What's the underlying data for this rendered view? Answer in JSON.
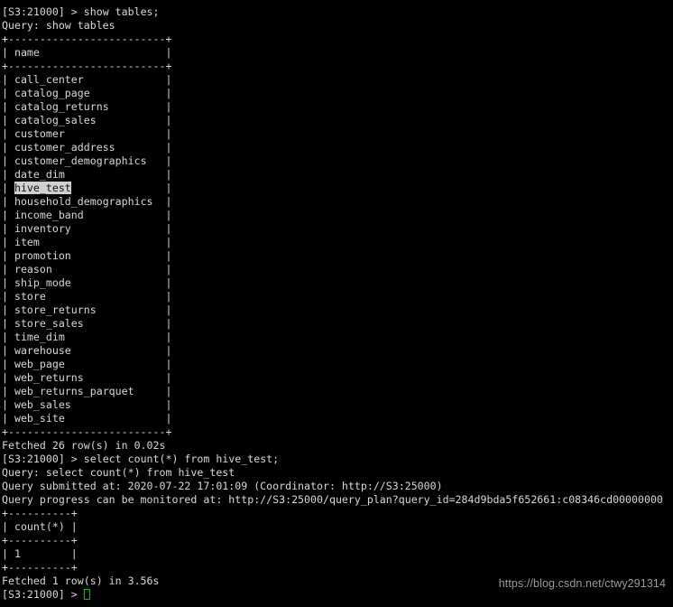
{
  "terminal": {
    "app": "impala-shell",
    "colors": {
      "background": "#000000",
      "foreground": "#d8d8d8",
      "cursor": "#00c000",
      "selection_background": "#d0d0d0",
      "selection_foreground": "#101010",
      "watermark": "#9a9a9a"
    },
    "prompt": "[S3:21000] > ",
    "cursor_glyph": "block-outline-cursor"
  },
  "session": {
    "command_1": {
      "prompt": "[S3:21000] > ",
      "input": "show tables;",
      "echo": "Query: show tables",
      "table": {
        "top_border": "+-------------------------+",
        "header_row": "| name                    |",
        "header_separator": "+-------------------------+",
        "bottom_border": "+-------------------------+",
        "column_header": "name",
        "rows": [
          "call_center",
          "catalog_page",
          "catalog_returns",
          "catalog_sales",
          "customer",
          "customer_address",
          "customer_demographics",
          "date_dim",
          "hive_test",
          "household_demographics",
          "income_band",
          "inventory",
          "item",
          "promotion",
          "reason",
          "ship_mode",
          "store",
          "store_returns",
          "store_sales",
          "time_dim",
          "warehouse",
          "web_page",
          "web_returns",
          "web_returns_parquet",
          "web_sales",
          "web_site"
        ],
        "selected_row": "hive_test",
        "selected_row_index": 8
      },
      "footer": "Fetched 26 row(s) in 0.02s"
    },
    "command_2": {
      "prompt": "[S3:21000] > ",
      "input": "select count(*) from hive_test;",
      "echo": "Query: select count(*) from hive_test",
      "submitted": "Query submitted at: 2020-07-22 17:01:09 (Coordinator: http://S3:25000)",
      "submitted_timestamp": "2020-07-22 17:01:09",
      "coordinator_url": "http://S3:25000",
      "progress": "Query progress can be monitored at: http://S3:25000/query_plan?query_id=284d9bda5f652661:c08346cd00000000",
      "query_id": "284d9bda5f652661:c08346cd00000000",
      "table": {
        "top_border": "+----------+",
        "header_row": "| count(*) |",
        "header_separator": "+----------+",
        "bottom_border": "+----------+",
        "column_header": "count(*)",
        "rows": [
          "| 1        |"
        ],
        "values": [
          "1"
        ]
      },
      "footer": "Fetched 1 row(s) in 3.56s"
    },
    "command_3": {
      "prompt": "[S3:21000] > ",
      "input": ""
    }
  },
  "watermark": {
    "text": "https://blog.csdn.net/ctwy291314"
  }
}
